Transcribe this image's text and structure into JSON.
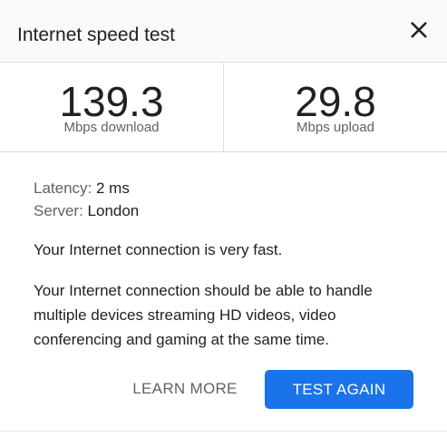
{
  "dialog": {
    "title": "Internet speed test",
    "close_icon": "close-icon"
  },
  "metrics": {
    "download": {
      "value": "139.3",
      "label": "Mbps download"
    },
    "upload": {
      "value": "29.8",
      "label": "Mbps upload"
    }
  },
  "details": {
    "latency": {
      "key": "Latency:",
      "value": "2 ms"
    },
    "server": {
      "key": "Server:",
      "value": "London"
    }
  },
  "messages": {
    "summary": "Your Internet connection is very fast.",
    "detail": "Your Internet connection should be able to handle multiple devices streaming HD videos, video conferencing and gaming at the same time."
  },
  "actions": {
    "learn_more_label": "LEARN MORE",
    "test_again_label": "TEST AGAIN"
  },
  "colors": {
    "accent": "#1a73e8",
    "header_bg": "#f8f9fa",
    "muted_text": "#5f6368"
  }
}
